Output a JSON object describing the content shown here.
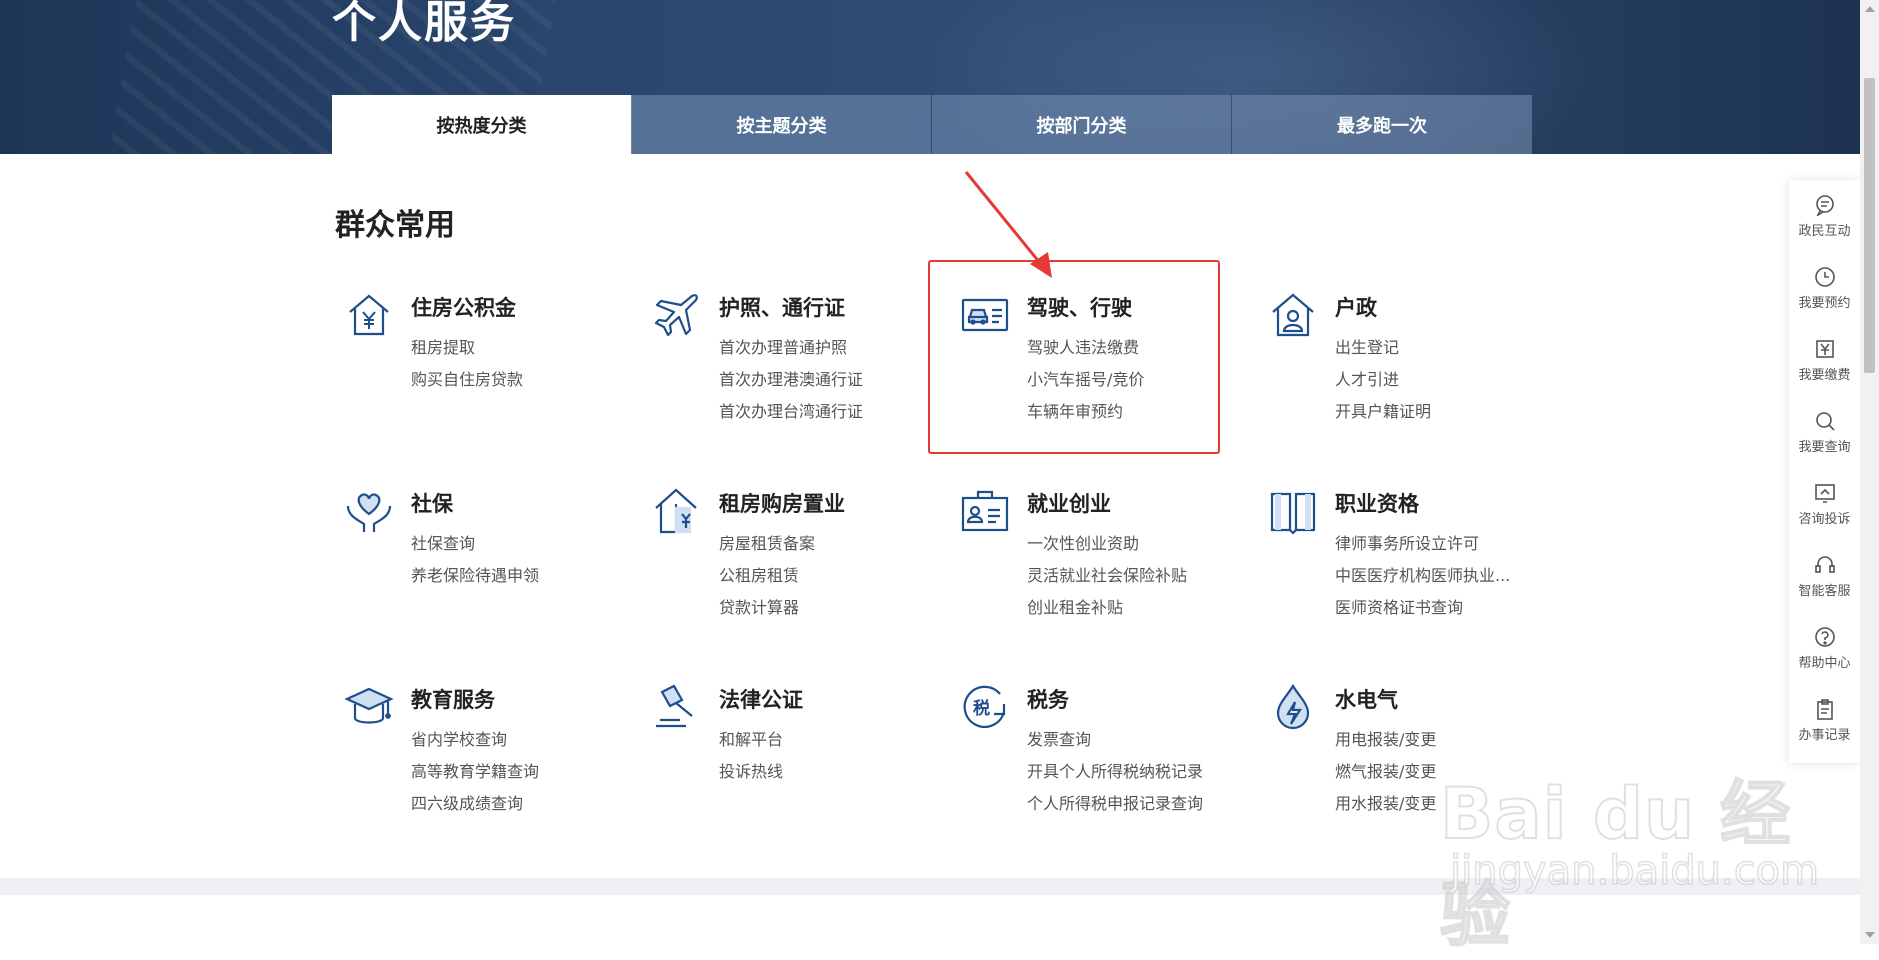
{
  "hero": {
    "title": "个人服务"
  },
  "tabs": [
    {
      "label": "按热度分类",
      "active": true
    },
    {
      "label": "按主题分类"
    },
    {
      "label": "按部门分类"
    },
    {
      "label": "最多跑一次"
    }
  ],
  "section": {
    "title": "群众常用"
  },
  "categories": [
    {
      "title": "住房公积金",
      "icon": "house-yuan-icon",
      "links": [
        "租房提取",
        "购买自住房贷款"
      ]
    },
    {
      "title": "护照、通行证",
      "icon": "airplane-icon",
      "links": [
        "首次办理普通护照",
        "首次办理港澳通行证",
        "首次办理台湾通行证"
      ]
    },
    {
      "title": "驾驶、行驶",
      "icon": "vehicle-license-icon",
      "links": [
        "驾驶人违法缴费",
        "小汽车摇号/竞价",
        "车辆年审预约"
      ]
    },
    {
      "title": "户政",
      "icon": "house-person-icon",
      "links": [
        "出生登记",
        "人才引进",
        "开具户籍证明"
      ]
    },
    {
      "title": "社保",
      "icon": "heart-hands-icon",
      "links": [
        "社保查询",
        "养老保险待遇申领"
      ]
    },
    {
      "title": "租房购房置业",
      "icon": "house-purchase-icon",
      "links": [
        "房屋租赁备案",
        "公租房租赁",
        "贷款计算器"
      ]
    },
    {
      "title": "就业创业",
      "icon": "briefcase-id-icon",
      "links": [
        "一次性创业资助",
        "灵活就业社会保险补贴",
        "创业租金补贴"
      ]
    },
    {
      "title": "职业资格",
      "icon": "open-book-icon",
      "links": [
        "律师事务所设立许可",
        "中医医疗机构医师执业...",
        "医师资格证书查询"
      ]
    },
    {
      "title": "教育服务",
      "icon": "graduation-cap-icon",
      "links": [
        "省内学校查询",
        "高等教育学籍查询",
        "四六级成绩查询"
      ]
    },
    {
      "title": "法律公证",
      "icon": "gavel-icon",
      "links": [
        "和解平台",
        "投诉热线"
      ]
    },
    {
      "title": "税务",
      "icon": "tax-icon",
      "links": [
        "发票查询",
        "开具个人所得税纳税记录",
        "个人所得税申报记录查询"
      ]
    },
    {
      "title": "水电气",
      "icon": "water-bolt-icon",
      "links": [
        "用电报装/变更",
        "燃气报装/变更",
        "用水报装/变更"
      ]
    }
  ],
  "rail": [
    {
      "label": "政民互动",
      "icon": "chat-icon"
    },
    {
      "label": "我要预约",
      "icon": "clock-icon"
    },
    {
      "label": "我要缴费",
      "icon": "payment-icon"
    },
    {
      "label": "我要查询",
      "icon": "search-icon"
    },
    {
      "label": "咨询投诉",
      "icon": "complaint-icon"
    },
    {
      "label": "智能客服",
      "icon": "headset-icon"
    },
    {
      "label": "帮助中心",
      "icon": "help-icon"
    },
    {
      "label": "办事记录",
      "icon": "clipboard-icon"
    }
  ],
  "watermark": {
    "main": "Bai du 经验",
    "sub": "jingyan.baidu.com"
  },
  "colors": {
    "highlight": "#e53935",
    "hero": "#2a466e",
    "iconBlue": "#1f4e8c"
  }
}
